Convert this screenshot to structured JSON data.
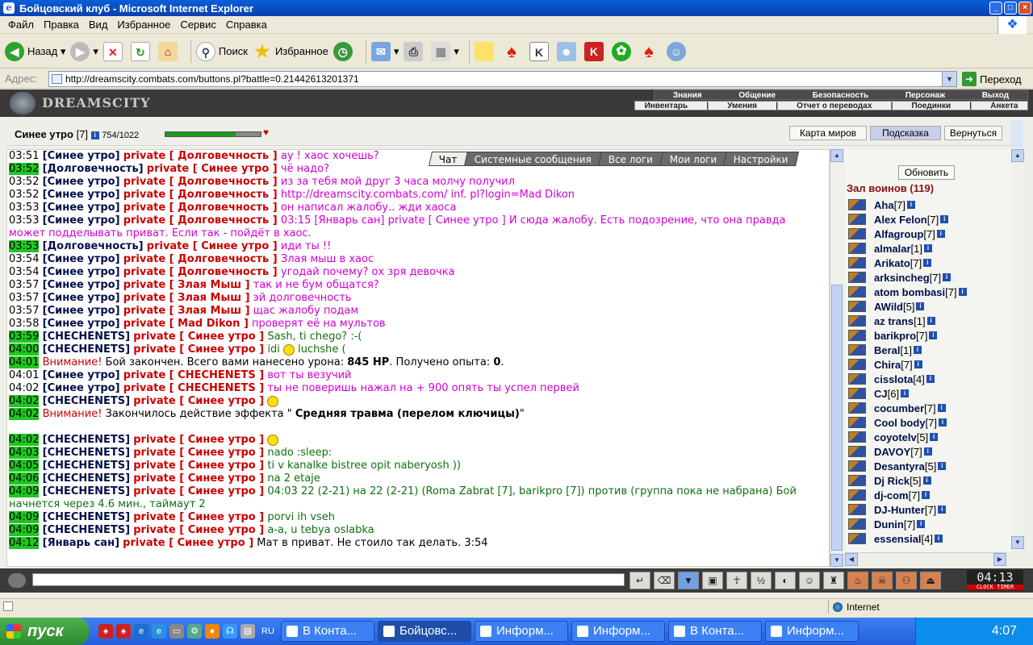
{
  "window": {
    "title": "Бойцовский клуб - Microsoft Internet Explorer"
  },
  "menu": [
    "Файл",
    "Правка",
    "Вид",
    "Избранное",
    "Сервис",
    "Справка"
  ],
  "toolbar": {
    "back": "Назад",
    "search": "Поиск",
    "favorites": "Избранное"
  },
  "address": {
    "label": "Адрес:",
    "url": "http://dreamscity.combats.com/buttons.pl?battle=0.21442613201371",
    "go": "Переход"
  },
  "game": {
    "logo": "DREAMSCITY",
    "topnav": [
      "Знания",
      "Общение",
      "Безопасность",
      "Персонаж",
      "Выход"
    ],
    "subnav": [
      "Инвентарь",
      "Умения",
      "Отчет о переводах",
      "Поединки",
      "Анкета"
    ],
    "character": {
      "name": "Синее утро",
      "level": "[7]",
      "hp": "754/1022",
      "hp_fraction": 0.74
    },
    "buttons": {
      "map": "Карта миров",
      "hint": "Подсказка",
      "back": "Вернуться"
    },
    "tabs": [
      "Чат",
      "Системные сообщения",
      "Все логи",
      "Мои логи",
      "Настройки"
    ],
    "chat": [
      {
        "t": "03:51",
        "g": false,
        "from": "Синее утро",
        "to": "Долговечность",
        "msg": "ау ! хаос хочешь?",
        "c": "m"
      },
      {
        "t": "03:52",
        "g": true,
        "from": "Долговечность",
        "to": "Синее утро",
        "msg": "чё надо?",
        "c": "m"
      },
      {
        "t": "03:52",
        "g": false,
        "from": "Синее утро",
        "to": "Долговечность",
        "msg": "из за тебя мой друг 3 часа молчу получил",
        "c": "m"
      },
      {
        "t": "03:52",
        "g": false,
        "from": "Синее утро",
        "to": "Долговечность",
        "msg": "http://dreamscity.combats.com/ inf. pl?login=Mad Dikon",
        "c": "m"
      },
      {
        "t": "03:53",
        "g": false,
        "from": "Синее утро",
        "to": "Долговечность",
        "msg": "он написал жалобу.. жди хаоса",
        "c": "m"
      },
      {
        "t": "03:53",
        "g": false,
        "from": "Синее утро",
        "to": "Долговечность",
        "msg": "03:15 [Январь сан] private [ Синее утро ] И сюда жалобу. Есть подозрение, что она правда может подделывать приват. Если так - пойдёт в хаос.",
        "c": "m",
        "wrap": true
      },
      {
        "t": "03:53",
        "g": true,
        "from": "Долговечность",
        "to": "Синее утро",
        "msg": "иди ты !!",
        "c": "m"
      },
      {
        "t": "03:54",
        "g": false,
        "from": "Синее утро",
        "to": "Долговечность",
        "msg": "Злая мыш в хаос",
        "c": "m"
      },
      {
        "t": "03:54",
        "g": false,
        "from": "Синее утро",
        "to": "Долговечность",
        "msg": "угодай почему? ох зря девочка",
        "c": "m"
      },
      {
        "t": "03:57",
        "g": false,
        "from": "Синее утро",
        "to": "Злая Мыш",
        "msg": "так и не бум общатся?",
        "c": "m"
      },
      {
        "t": "03:57",
        "g": false,
        "from": "Синее утро",
        "to": "Злая Мыш",
        "msg": "эй долговечность",
        "c": "m"
      },
      {
        "t": "03:57",
        "g": false,
        "from": "Синее утро",
        "to": "Злая Мыш",
        "msg": "щас жалобу подам",
        "c": "m"
      },
      {
        "t": "03:58",
        "g": false,
        "from": "Синее утро",
        "to": "Mad Dikon",
        "msg": "проверят её на мультов",
        "c": "m"
      },
      {
        "t": "03:59",
        "g": true,
        "from": "CHECHENETS",
        "to": "Синее утро",
        "msg": "Sash, ti chego? :-(",
        "c": "g"
      },
      {
        "t": "04:00",
        "g": true,
        "from": "CHECHENETS",
        "to": "Синее утро",
        "msg": "idi",
        "msg2": "luchshe (",
        "smiley": true,
        "c": "g"
      },
      {
        "t": "04:01",
        "g": true,
        "sys": true,
        "warn": "Внимание!",
        "text": "Бой закончен. Всего вами нанесено урона:",
        "b1": "845 HP",
        "text2": ". Получено опыта:",
        "b2": "0",
        "text3": "."
      },
      {
        "t": "04:01",
        "g": false,
        "from": "Синее утро",
        "to": "CHECHENETS",
        "msg": "вот ты везучий",
        "c": "m"
      },
      {
        "t": "04:02",
        "g": false,
        "from": "Синее утро",
        "to": "CHECHENETS",
        "msg": "ты не поверишь нажал на + 900 опять ты успел первей",
        "c": "m"
      },
      {
        "t": "04:02",
        "g": true,
        "from": "CHECHENETS",
        "to": "Синее утро",
        "msg": "",
        "smileyOnly": true,
        "c": "g"
      },
      {
        "t": "04:02",
        "g": true,
        "sys": true,
        "warn": "Внимание!",
        "text": "Закончилось действие эффекта \"",
        "b1": "Средняя травма (перелом ключицы)",
        "text2": "\"",
        "b2": "",
        "text3": ""
      },
      {
        "blank": true
      },
      {
        "t": "04:02",
        "g": true,
        "from": "CHECHENETS",
        "to": "Синее утро",
        "msg": "",
        "smileyOnly": true,
        "c": "g"
      },
      {
        "t": "04:03",
        "g": true,
        "from": "CHECHENETS",
        "to": "Синее утро",
        "msg": "nado :sleep:",
        "c": "g"
      },
      {
        "t": "04:05",
        "g": true,
        "from": "CHECHENETS",
        "to": "Синее утро",
        "msg": "ti v kanalke bistree opit naberyosh ))",
        "c": "g"
      },
      {
        "t": "04:06",
        "g": true,
        "from": "CHECHENETS",
        "to": "Синее утро",
        "msg": "na 2 etaje",
        "c": "g"
      },
      {
        "t": "04:09",
        "g": true,
        "from": "CHECHENETS",
        "to": "Синее утро",
        "msg": "04:03 22 (2-21) на 22 (2-21) (Roma Zabrat [7], barikpro [7]) против (группа пока не набрана) Бой начнется через 4.6 мин., таймаут 2",
        "c": "g",
        "wrap": true
      },
      {
        "t": "04:09",
        "g": true,
        "from": "CHECHENETS",
        "to": "Синее утро",
        "msg": "porvi ih vseh",
        "c": "g"
      },
      {
        "t": "04:09",
        "g": true,
        "from": "CHECHENETS",
        "to": "Синее утро",
        "msg": "a-a, u tebya oslabka",
        "c": "g"
      },
      {
        "t": "04:12",
        "g": true,
        "from": "Январь сан",
        "to": "Синее утро",
        "msg": "Мат в приват. Не стоило так делать. 3:54",
        "c": "k"
      }
    ],
    "refresh": "Обновить",
    "hall": "Зал воинов (119)",
    "users": [
      {
        "n": "Aha",
        "l": "[7]"
      },
      {
        "n": "Alex Felon",
        "l": "[7]"
      },
      {
        "n": "Alfagroup",
        "l": "[7]"
      },
      {
        "n": "almalar",
        "l": "[1]"
      },
      {
        "n": "Arikato",
        "l": "[7]"
      },
      {
        "n": "arksincheg",
        "l": "[7]"
      },
      {
        "n": "atom bombasi",
        "l": "[7]"
      },
      {
        "n": "AWild",
        "l": "[5]"
      },
      {
        "n": "az trans",
        "l": "[1]"
      },
      {
        "n": "barikpro",
        "l": "[7]"
      },
      {
        "n": "Beral",
        "l": "[1]"
      },
      {
        "n": "Chira",
        "l": "[7]"
      },
      {
        "n": "cisslota",
        "l": "[4]"
      },
      {
        "n": "CJ",
        "l": "[6]"
      },
      {
        "n": "cocumber",
        "l": "[7]"
      },
      {
        "n": "Cool body",
        "l": "[7]"
      },
      {
        "n": "coyotelv",
        "l": "[5]"
      },
      {
        "n": "DAVOY",
        "l": "[7]"
      },
      {
        "n": "Desantyra",
        "l": "[5]"
      },
      {
        "n": "Dj Rick",
        "l": "[5]"
      },
      {
        "n": "dj-com",
        "l": "[7]"
      },
      {
        "n": "DJ-Hunter",
        "l": "[7]"
      },
      {
        "n": "Dunin",
        "l": "[7]"
      },
      {
        "n": "essensial",
        "l": "[4]"
      }
    ],
    "clock": {
      "time": "04:13",
      "label": "CLOCK TIMER"
    }
  },
  "status": {
    "zone": "Internet"
  },
  "taskbar": {
    "start": "пуск",
    "quick": "RU",
    "tasks": [
      {
        "label": "В Конта...",
        "active": false
      },
      {
        "label": "Бойцовс...",
        "active": true
      },
      {
        "label": "Информ...",
        "active": false
      },
      {
        "label": "Информ...",
        "active": false
      },
      {
        "label": "В Конта...",
        "active": false
      },
      {
        "label": "Информ...",
        "active": false
      }
    ],
    "time": "4:07"
  }
}
